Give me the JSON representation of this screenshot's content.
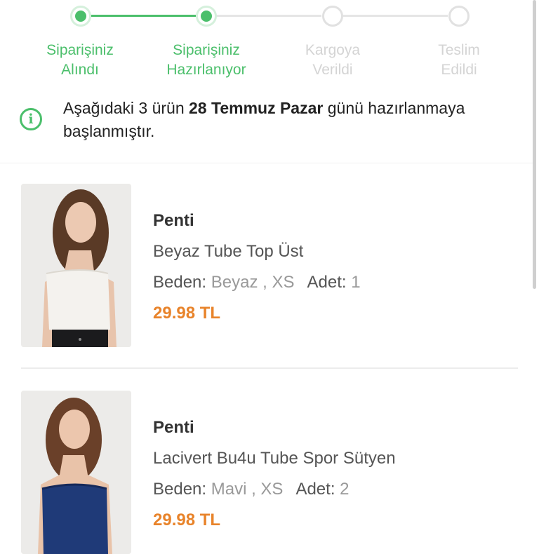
{
  "stepper": {
    "steps": [
      {
        "line1": "Siparişiniz",
        "line2": "Alındı",
        "status": "done"
      },
      {
        "line1": "Siparişiniz",
        "line2": "Hazırlanıyor",
        "status": "done"
      },
      {
        "line1": "Kargoya",
        "line2": "Verildi",
        "status": "pending"
      },
      {
        "line1": "Teslim",
        "line2": "Edildi",
        "status": "pending"
      }
    ]
  },
  "info": {
    "icon": "info-circle-icon",
    "prefix": "Aşağıdaki 3 ürün ",
    "date": "28 Temmuz Pazar",
    "suffix": " günü hazırlanmaya başlanmıştır."
  },
  "products": [
    {
      "brand": "Penti",
      "name": "Beyaz Tube Top Üst",
      "size_label": "Beden:",
      "size_value": "Beyaz , XS",
      "qty_label": "Adet:",
      "qty_value": "1",
      "price": "29.98 TL",
      "garment_color": "#f4f2ee"
    },
    {
      "brand": "Penti",
      "name": "Lacivert Bu4u Tube Spor Sütyen",
      "size_label": "Beden:",
      "size_value": "Mavi , XS",
      "qty_label": "Adet:",
      "qty_value": "2",
      "price": "29.98 TL",
      "garment_color": "#1f3a78"
    }
  ],
  "colors": {
    "accent": "#4bbf6b",
    "price": "#e8832a",
    "pending": "#d4d4d4"
  }
}
